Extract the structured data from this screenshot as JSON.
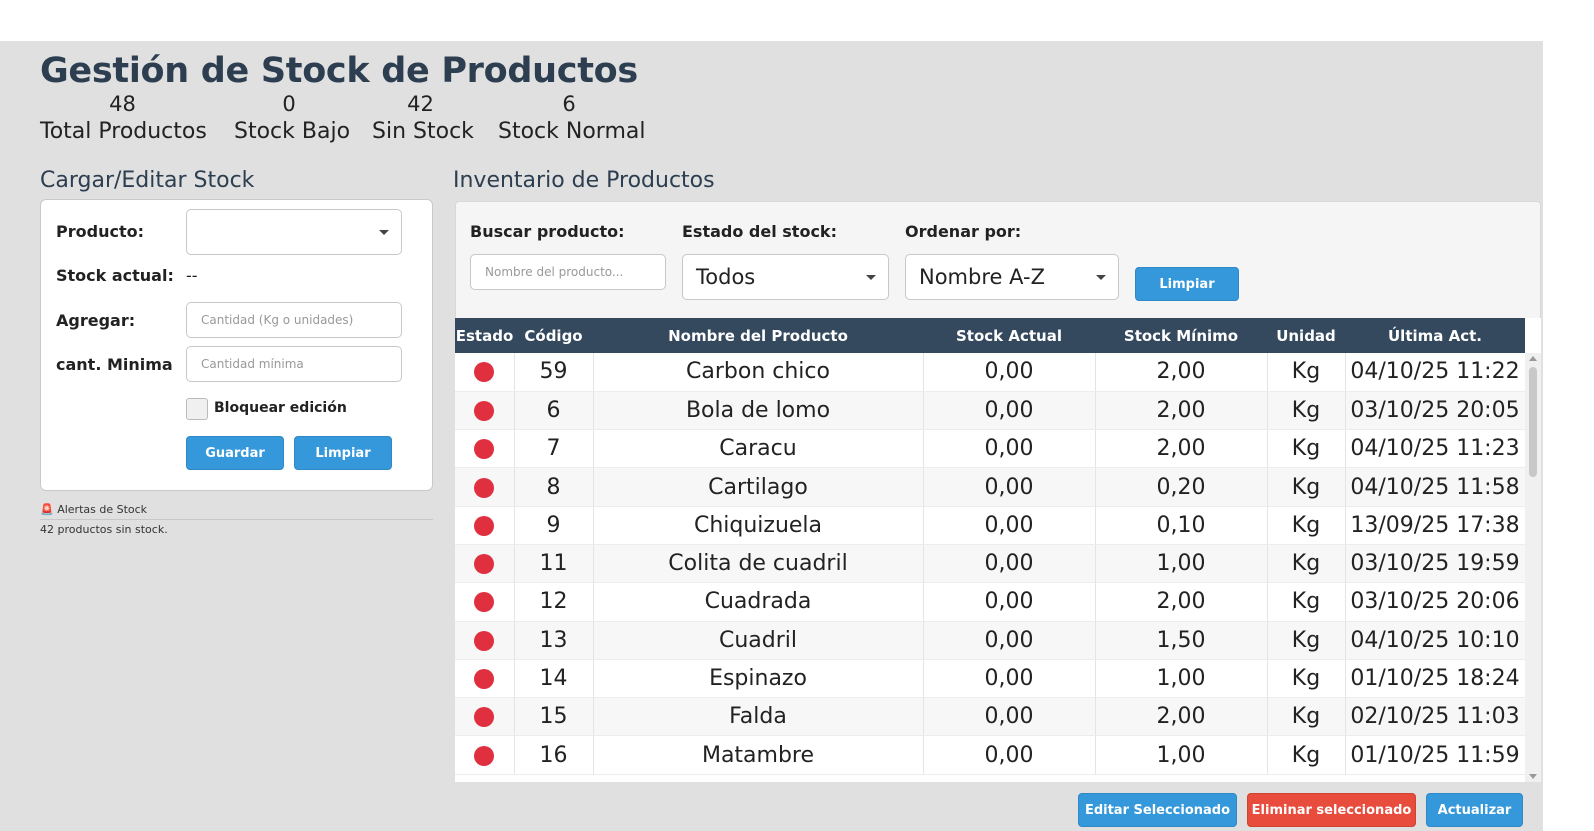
{
  "header": {
    "title": "Gestión de Stock de Productos",
    "stats": [
      {
        "value": "48",
        "label": "Total Productos"
      },
      {
        "value": "0",
        "label": "Stock Bajo"
      },
      {
        "value": "42",
        "label": "Sin Stock"
      },
      {
        "value": "6",
        "label": "Stock Normal"
      }
    ]
  },
  "form": {
    "section_title": "Cargar/Editar Stock",
    "product_label": "Producto:",
    "product_value": "",
    "stock_label": "Stock actual:",
    "stock_value": "--",
    "add_label": "Agregar:",
    "add_placeholder": "Cantidad (Kg o unidades)",
    "min_label": "cant. Minima",
    "min_placeholder": "Cantidad mínima",
    "lock_label": "Bloquear edición",
    "save_button": "Guardar",
    "clear_button": "Limpiar"
  },
  "alerts": {
    "header": "🚨 Alertas de Stock",
    "message": "42 productos sin stock."
  },
  "inventory": {
    "section_title": "Inventario de Productos",
    "search_label": "Buscar producto:",
    "search_placeholder": "Nombre del producto...",
    "status_label": "Estado del stock:",
    "status_value": "Todos",
    "sort_label": "Ordenar por:",
    "sort_value": "Nombre A-Z",
    "clear_button": "Limpiar",
    "columns": [
      "Estado",
      "Código",
      "Nombre del Producto",
      "Stock Actual",
      "Stock Mínimo",
      "Unidad",
      "Última Act."
    ],
    "status_color": "#e03040",
    "rows": [
      {
        "code": "59",
        "name": "Carbon chico",
        "stock": "0,00",
        "min": "2,00",
        "unit": "Kg",
        "updated": "04/10/25 11:22"
      },
      {
        "code": "6",
        "name": "Bola de lomo",
        "stock": "0,00",
        "min": "2,00",
        "unit": "Kg",
        "updated": "03/10/25 20:05"
      },
      {
        "code": "7",
        "name": "Caracu",
        "stock": "0,00",
        "min": "2,00",
        "unit": "Kg",
        "updated": "04/10/25 11:23"
      },
      {
        "code": "8",
        "name": "Cartilago",
        "stock": "0,00",
        "min": "0,20",
        "unit": "Kg",
        "updated": "04/10/25 11:58"
      },
      {
        "code": "9",
        "name": "Chiquizuela",
        "stock": "0,00",
        "min": "0,10",
        "unit": "Kg",
        "updated": "13/09/25 17:38"
      },
      {
        "code": "11",
        "name": "Colita de cuadril",
        "stock": "0,00",
        "min": "1,00",
        "unit": "Kg",
        "updated": "03/10/25 19:59"
      },
      {
        "code": "12",
        "name": "Cuadrada",
        "stock": "0,00",
        "min": "2,00",
        "unit": "Kg",
        "updated": "03/10/25 20:06"
      },
      {
        "code": "13",
        "name": "Cuadril",
        "stock": "0,00",
        "min": "1,50",
        "unit": "Kg",
        "updated": "04/10/25 10:10"
      },
      {
        "code": "14",
        "name": "Espinazo",
        "stock": "0,00",
        "min": "1,00",
        "unit": "Kg",
        "updated": "01/10/25 18:24"
      },
      {
        "code": "15",
        "name": "Falda",
        "stock": "0,00",
        "min": "2,00",
        "unit": "Kg",
        "updated": "02/10/25 11:03"
      },
      {
        "code": "16",
        "name": "Matambre",
        "stock": "0,00",
        "min": "1,00",
        "unit": "Kg",
        "updated": "01/10/25 11:59"
      }
    ]
  },
  "actions": {
    "edit_button": "Editar Seleccionado",
    "delete_button": "Eliminar seleccionado",
    "refresh_button": "Actualizar"
  }
}
